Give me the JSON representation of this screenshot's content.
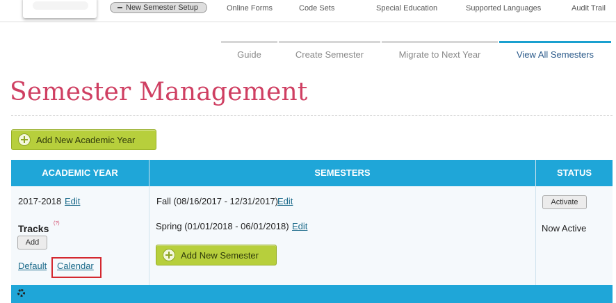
{
  "top_nav": {
    "pill_label": "New Semester Setup",
    "links": [
      "Online Forms",
      "Code Sets",
      "Special Education",
      "Supported Languages",
      "Audit Trail"
    ]
  },
  "tabs": [
    {
      "label": "Guide",
      "active": false
    },
    {
      "label": "Create Semester",
      "active": false
    },
    {
      "label": "Migrate to Next Year",
      "active": false
    },
    {
      "label": "View All Semesters",
      "active": true
    }
  ],
  "page_title": "Semester Management",
  "add_year_button": "Add New Academic Year",
  "table": {
    "headers": [
      "ACADEMIC YEAR",
      "SEMESTERS",
      "STATUS"
    ],
    "row": {
      "year": "2017-2018",
      "edit_label": "Edit",
      "tracks_label": "Tracks",
      "tracks_help": "(?)",
      "add_label": "Add",
      "default_link": "Default",
      "calendar_link": "Calendar",
      "semesters": [
        {
          "label": "Fall (08/16/2017 - 12/31/2017)",
          "edit": "Edit"
        },
        {
          "label": "Spring (01/01/2018 - 06/01/2018)",
          "edit": "Edit"
        }
      ],
      "add_semester_button": "Add New Semester",
      "activate_label": "Activate",
      "status_text": "Now Active"
    }
  },
  "colors": {
    "accent_blue": "#1fa6d8",
    "title_pink": "#cf3f62",
    "button_green": "#b7cf3c",
    "highlight_red": "#d4282f"
  }
}
